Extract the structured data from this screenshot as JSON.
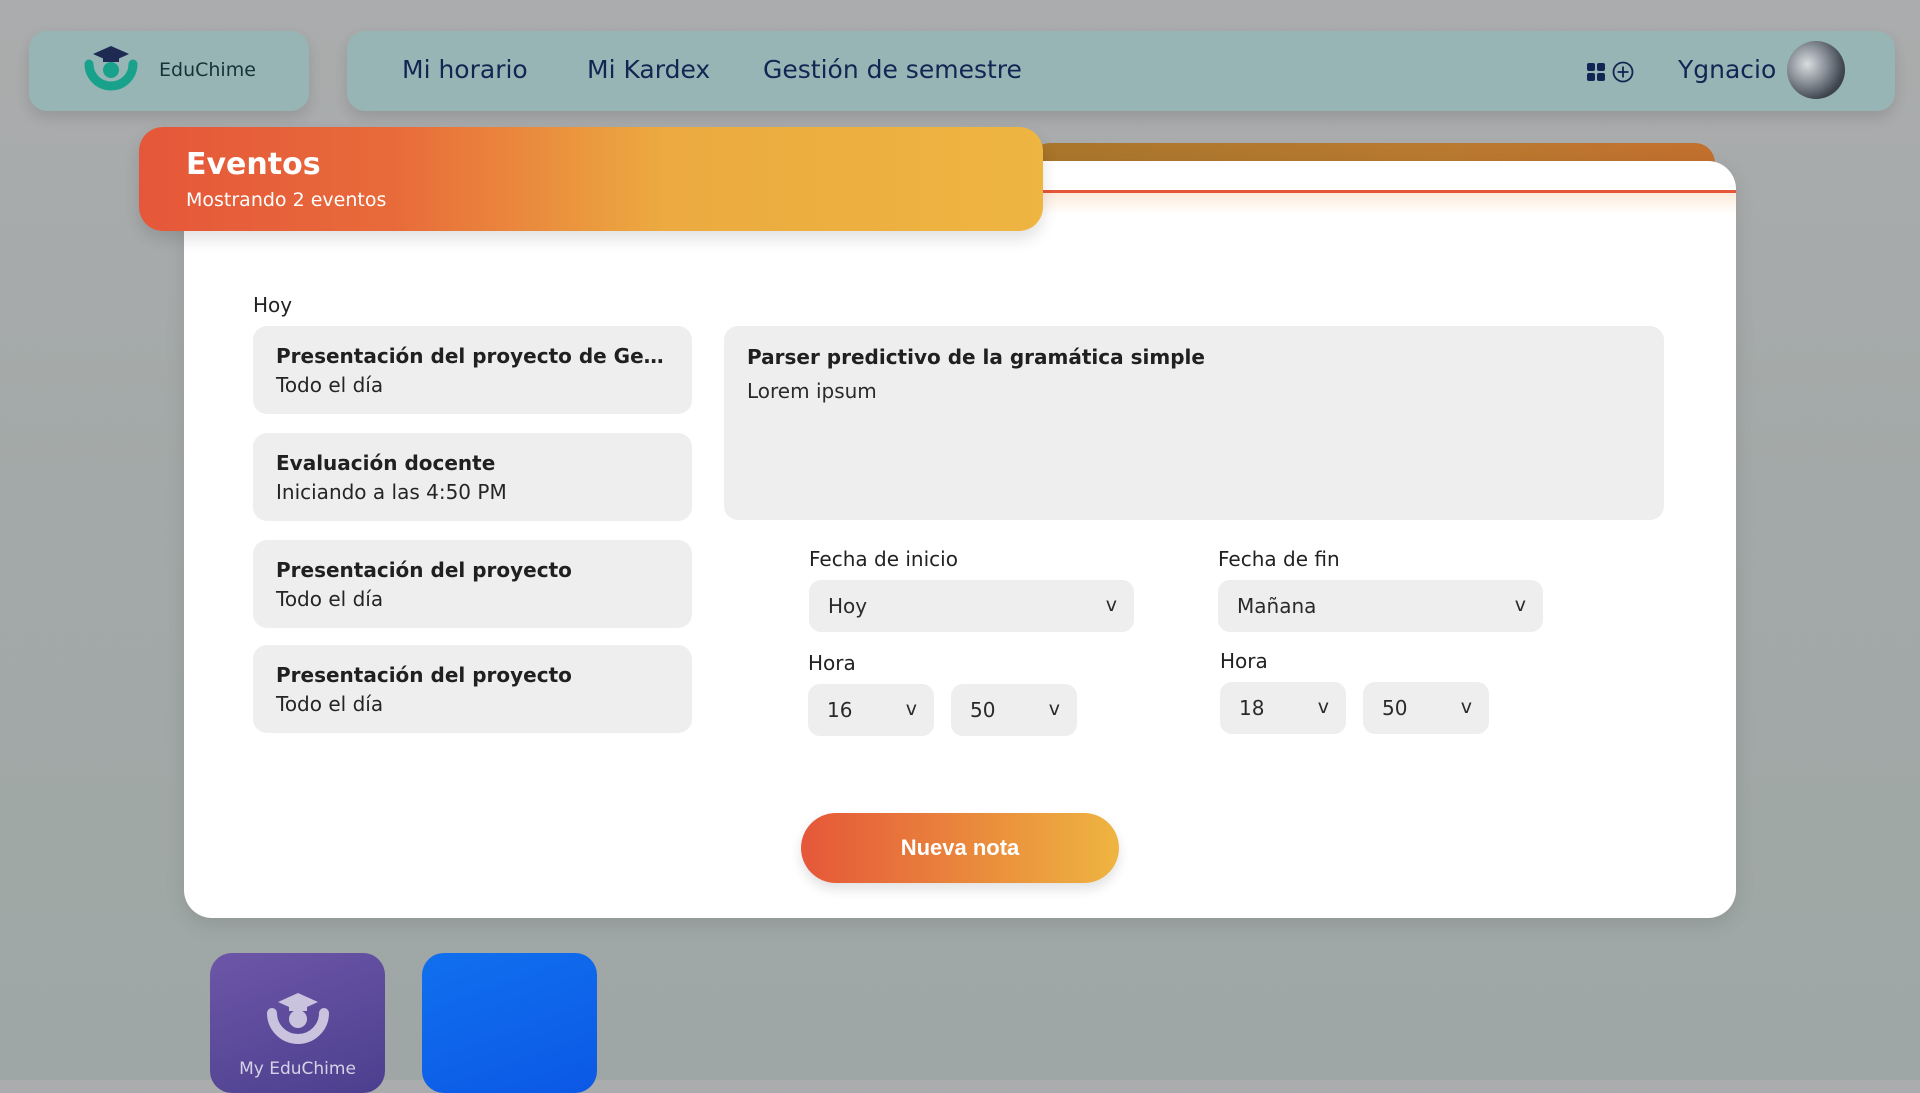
{
  "topbar": {
    "brand": "EduChime",
    "nav": [
      "Mi horario",
      "Mi Kardex",
      "Gestión de semestre"
    ],
    "user_name": "Ygnacio",
    "icons": [
      "apps-grid-icon",
      "add-circle-icon"
    ]
  },
  "events_panel": {
    "title": "Eventos",
    "subtitle": "Mostrando 2 eventos",
    "group_label": "Hoy",
    "events": [
      {
        "title": "Presentación del proyecto de Gestión de proyectos",
        "time": "Todo el día"
      },
      {
        "title": "Evaluación docente",
        "time": "Iniciando a las 4:50 PM"
      },
      {
        "title": "Presentación del proyecto",
        "time": "Todo el día"
      },
      {
        "title": "Presentación del proyecto",
        "time": "Todo el día"
      }
    ]
  },
  "detail": {
    "title": "Parser predictivo de la gramática simple",
    "description": "Lorem ipsum"
  },
  "form": {
    "start_date_label": "Fecha de inicio",
    "start_date_value": "Hoy",
    "end_date_label": "Fecha de fin",
    "end_date_value": "Mañana",
    "start_time_label": "Hora",
    "start_hour": "16",
    "start_minute": "50",
    "end_time_label": "Hora",
    "end_hour": "18",
    "end_minute": "50",
    "chevron": "v"
  },
  "actions": {
    "new_note": "Nueva nota"
  },
  "dock": {
    "apps": [
      {
        "label": "My EduChime",
        "icon": "educhime-logo-icon",
        "color": "#5a4a9a"
      },
      {
        "label": "",
        "icon": "",
        "color": "#0d63ea"
      }
    ]
  },
  "colors": {
    "accent_orange": "#e5573a",
    "accent_yellow": "#eeb541",
    "brand_teal": "#18a28c",
    "nav_text": "#132553"
  }
}
